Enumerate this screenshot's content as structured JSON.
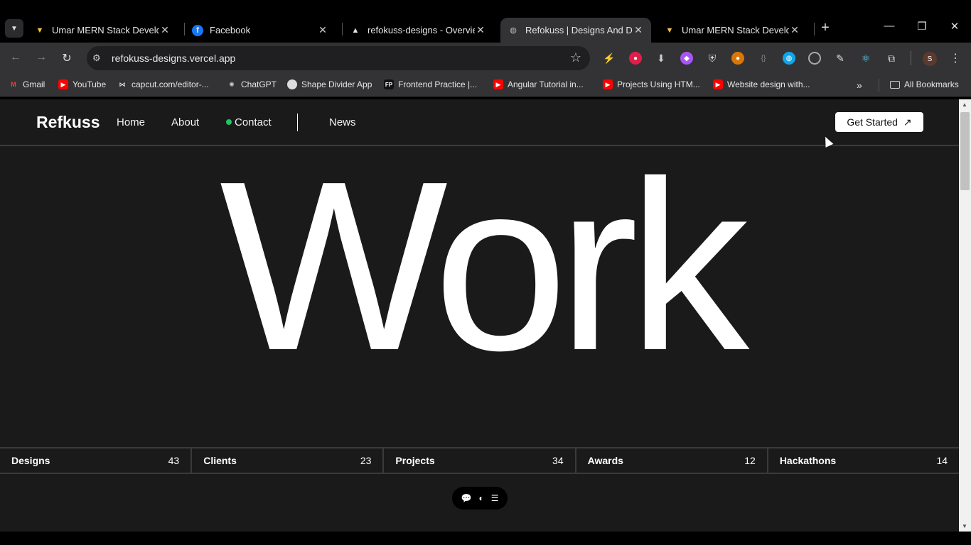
{
  "browser": {
    "tabs": [
      {
        "title": "Umar MERN Stack Develope",
        "icon": "vercel-v-icon",
        "active": false
      },
      {
        "title": "Facebook",
        "icon": "facebook-icon",
        "active": false
      },
      {
        "title": "refokuss-designs - Overview",
        "icon": "vercel-triangle-icon",
        "active": false
      },
      {
        "title": "Refokuss | Designs And Dev",
        "icon": "globe-icon",
        "active": true
      },
      {
        "title": "Umar MERN Stack Develope",
        "icon": "vercel-v-icon",
        "active": false
      }
    ],
    "url": "refokuss-designs.vercel.app",
    "bookmarks": [
      {
        "label": "Gmail",
        "icon": "gmail-icon",
        "color": "#ea4335"
      },
      {
        "label": "YouTube",
        "icon": "youtube-icon",
        "color": "#ff0000"
      },
      {
        "label": "capcut.com/editor-...",
        "icon": "capcut-icon",
        "color": "#333333"
      },
      {
        "label": "ChatGPT",
        "icon": "chatgpt-icon",
        "color": "#444444"
      },
      {
        "label": "Shape Divider App",
        "icon": "shape-divider-icon",
        "color": "#dddddd"
      },
      {
        "label": "Frontend Practice |...",
        "icon": "fp-icon",
        "color": "#222222"
      },
      {
        "label": "Angular Tutorial in...",
        "icon": "youtube-icon",
        "color": "#ff0000"
      },
      {
        "label": "Projects Using HTM...",
        "icon": "youtube-icon",
        "color": "#ff0000"
      },
      {
        "label": "Website design with...",
        "icon": "youtube-icon",
        "color": "#ff0000"
      }
    ],
    "all_bookmarks_label": "All Bookmarks",
    "profile_initial": "S"
  },
  "site": {
    "brand": "Refkuss",
    "nav": {
      "home": "Home",
      "about": "About",
      "contact": "Contact",
      "news": "News"
    },
    "cta_label": "Get Started",
    "cta_icon": "↗",
    "hero_text": "Work",
    "stats": [
      {
        "label": "Designs",
        "count": "43"
      },
      {
        "label": "Clients",
        "count": "23"
      },
      {
        "label": "Projects",
        "count": "34"
      },
      {
        "label": "Awards",
        "count": "12"
      },
      {
        "label": "Hackathons",
        "count": "14"
      }
    ],
    "colors": {
      "background": "#1a1a1b",
      "accent_dot": "#22c55e",
      "text": "#ffffff"
    }
  }
}
